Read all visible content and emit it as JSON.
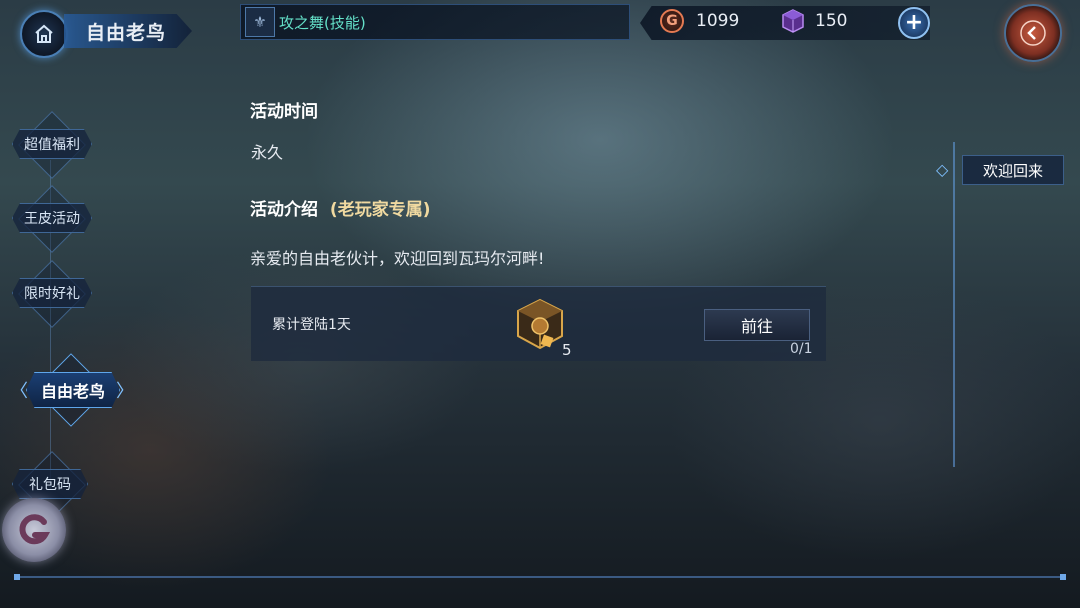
{
  "header": {
    "title": "自由老鸟",
    "notice": "攻之舞(技能)"
  },
  "currency": {
    "gold_symbol": "G",
    "gold": "1099",
    "gems": "150",
    "plus": "+"
  },
  "sidebar": {
    "items": [
      {
        "label": "超值福利"
      },
      {
        "label": "王皮活动"
      },
      {
        "label": "限时好礼"
      },
      {
        "label": "自由老鸟",
        "active": true
      },
      {
        "label": "礼包码"
      }
    ]
  },
  "content": {
    "time_title": "活动时间",
    "time_value": "永久",
    "intro_title": "活动介绍",
    "intro_subtitle": "(老玩家专属)",
    "intro_text": "亲爱的自由老伙计，欢迎回到瓦玛尔河畔!",
    "task": {
      "label": "累计登陆1天",
      "reward_count": "5",
      "button": "前往",
      "progress": "0/1"
    }
  },
  "right_panel": {
    "tab": "欢迎回来"
  },
  "colors": {
    "accent_blue": "#5fa6ea",
    "notice_text": "#64e0c8",
    "subtitle": "#f0d9a0",
    "back_button": "#c55a3f"
  }
}
